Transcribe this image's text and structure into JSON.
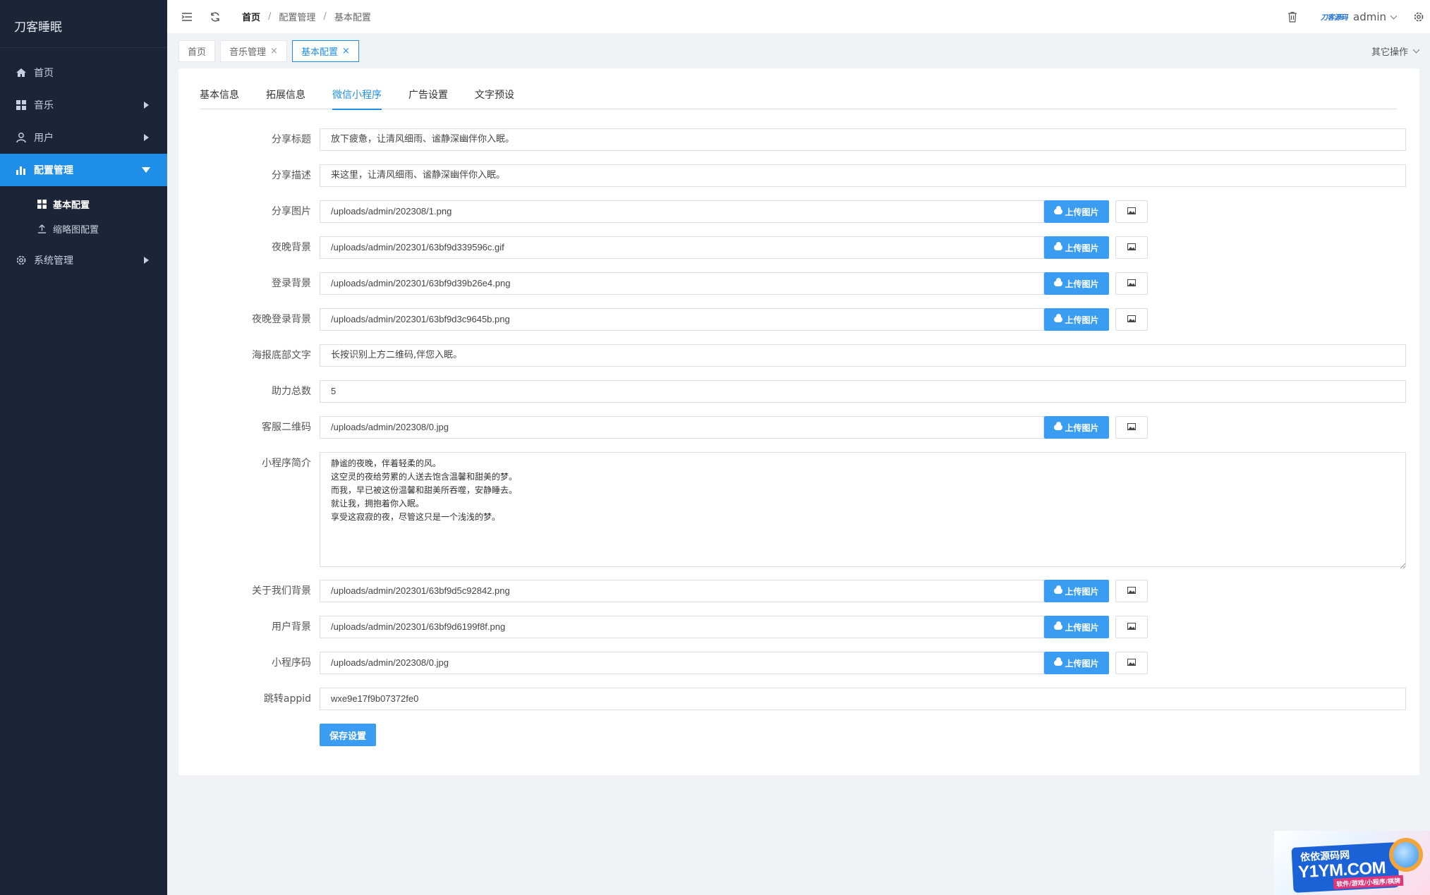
{
  "app": {
    "title": "刀客睡眠"
  },
  "sidebar": {
    "items": [
      {
        "label": "首页",
        "icon": "home-icon"
      },
      {
        "label": "音乐",
        "icon": "grid-icon",
        "has_children": true
      },
      {
        "label": "用户",
        "icon": "user-icon",
        "has_children": true
      },
      {
        "label": "配置管理",
        "icon": "bar-chart-icon",
        "active": true,
        "expanded": true
      },
      {
        "label": "系统管理",
        "icon": "gear-icon",
        "has_children": true
      }
    ],
    "submenu": [
      {
        "label": "基本配置",
        "icon": "grid-icon",
        "current": true
      },
      {
        "label": "缩略图配置",
        "icon": "upload-icon"
      }
    ]
  },
  "header": {
    "breadcrumb": [
      "首页",
      "配置管理",
      "基本配置"
    ],
    "brand_mini": "刀客源码",
    "user": "admin"
  },
  "page_tabs": [
    {
      "label": "首页",
      "closable": false
    },
    {
      "label": "音乐管理",
      "closable": true
    },
    {
      "label": "基本配置",
      "closable": true,
      "active": true
    }
  ],
  "other_ops": "其它操作",
  "form_tabs": [
    "基本信息",
    "拓展信息",
    "微信小程序",
    "广告设置",
    "文字预设"
  ],
  "active_form_tab": "微信小程序",
  "upload_label": "上传图片",
  "save_label": "保存设置",
  "fields": {
    "share_title": {
      "label": "分享标题",
      "value": "放下疲惫，让清风细雨、谧静深幽伴你入眠。"
    },
    "share_desc": {
      "label": "分享描述",
      "value": "来这里，让清风细雨、谧静深幽伴你入眠。"
    },
    "share_image": {
      "label": "分享图片",
      "value": "/uploads/admin/202308/1.png"
    },
    "night_bg": {
      "label": "夜晚背景",
      "value": "/uploads/admin/202301/63bf9d339596c.gif"
    },
    "login_bg": {
      "label": "登录背景",
      "value": "/uploads/admin/202301/63bf9d39b26e4.png"
    },
    "night_login_bg": {
      "label": "夜晚登录背景",
      "value": "/uploads/admin/202301/63bf9d3c9645b.png"
    },
    "poster_text": {
      "label": "海报底部文字",
      "value": "长按识别上方二维码,伴您入眠。"
    },
    "assist_total": {
      "label": "助力总数",
      "value": "5"
    },
    "service_qr": {
      "label": "客服二维码",
      "value": "/uploads/admin/202308/0.jpg"
    },
    "intro": {
      "label": "小程序简介",
      "value": "静谧的夜晚，伴着轻柔的风。\n这空灵的夜给劳累的人送去饱含温馨和甜美的梦。\n而我，早已被这份温馨和甜美所吞噬，安静睡去。\n就让我，拥抱着你入眠。\n享受这寂寂的夜，尽管这只是一个浅浅的梦。"
    },
    "about_bg": {
      "label": "关于我们背景",
      "value": "/uploads/admin/202301/63bf9d5c92842.png"
    },
    "user_bg": {
      "label": "用户背景",
      "value": "/uploads/admin/202301/63bf9d6199f8f.png"
    },
    "mini_code": {
      "label": "小程序码",
      "value": "/uploads/admin/202308/0.jpg"
    },
    "jump_appid": {
      "label": "跳转appid",
      "value": "wxe9e17f9b07372fe0"
    }
  },
  "watermark": {
    "top": "依依源码网",
    "main": "Y1YM.COM",
    "sub": "软件/游戏/小程序/棋牌"
  },
  "colors": {
    "sidebar_bg": "#1c2438",
    "accent": "#1f8ee8",
    "button": "#3a9df2"
  }
}
